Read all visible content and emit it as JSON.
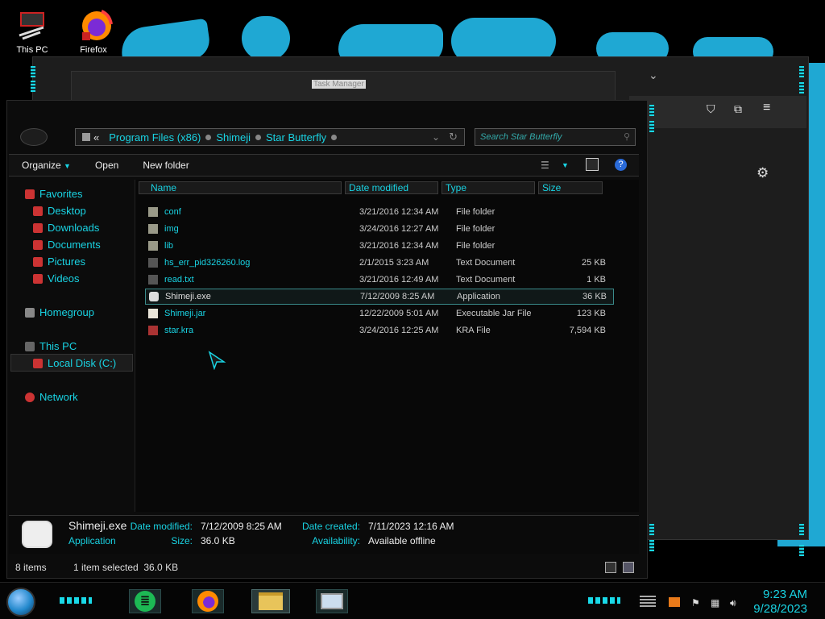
{
  "desktop": {
    "icons": [
      {
        "label": "This PC"
      },
      {
        "label": "Firefox"
      }
    ]
  },
  "background_windows": {
    "task_manager_title": "Task Manager"
  },
  "explorer": {
    "breadcrumbs": [
      "«",
      "Program Files (x86)",
      "Shimeji",
      "Star Butterfly"
    ],
    "search_placeholder": "Search Star Butterfly",
    "toolbar": {
      "organize": "Organize",
      "open": "Open",
      "new_folder": "New folder"
    },
    "nav": {
      "favorites": "Favorites",
      "desktop": "Desktop",
      "downloads": "Downloads",
      "documents": "Documents",
      "pictures": "Pictures",
      "videos": "Videos",
      "homegroup": "Homegroup",
      "this_pc": "This PC",
      "local_disk": "Local Disk (C:)",
      "network": "Network"
    },
    "columns": {
      "name": "Name",
      "date": "Date modified",
      "type": "Type",
      "size": "Size"
    },
    "files": [
      {
        "name": "conf",
        "date": "3/21/2016 12:34 AM",
        "type": "File folder",
        "size": ""
      },
      {
        "name": "img",
        "date": "3/24/2016 12:27 AM",
        "type": "File folder",
        "size": ""
      },
      {
        "name": "lib",
        "date": "3/21/2016 12:34 AM",
        "type": "File folder",
        "size": ""
      },
      {
        "name": "hs_err_pid326260.log",
        "date": "2/1/2015 3:23 AM",
        "type": "Text Document",
        "size": "25 KB"
      },
      {
        "name": "read.txt",
        "date": "3/21/2016 12:49 AM",
        "type": "Text Document",
        "size": "1 KB"
      },
      {
        "name": "Shimeji.exe",
        "date": "7/12/2009 8:25 AM",
        "type": "Application",
        "size": "36 KB"
      },
      {
        "name": "Shimeji.jar",
        "date": "12/22/2009 5:01 AM",
        "type": "Executable Jar File",
        "size": "123 KB"
      },
      {
        "name": "star.kra",
        "date": "3/24/2016 12:25 AM",
        "type": "KRA File",
        "size": "7,594 KB"
      }
    ],
    "details": {
      "name": "Shimeji.exe",
      "kind": "Application",
      "date_modified_label": "Date modified:",
      "date_modified": "7/12/2009 8:25 AM",
      "size_label": "Size:",
      "size": "36.0 KB",
      "date_created_label": "Date created:",
      "date_created": "7/11/2023 12:16 AM",
      "availability_label": "Availability:",
      "availability": "Available offline"
    },
    "status": {
      "count": "8 items",
      "selection": "1 item selected  36.0 KB"
    }
  },
  "taskbar": {
    "time": "9:23 AM",
    "date": "9/28/2023"
  },
  "colors": {
    "accent": "#19d3e3",
    "wallpaper": "#1fa8d3"
  }
}
